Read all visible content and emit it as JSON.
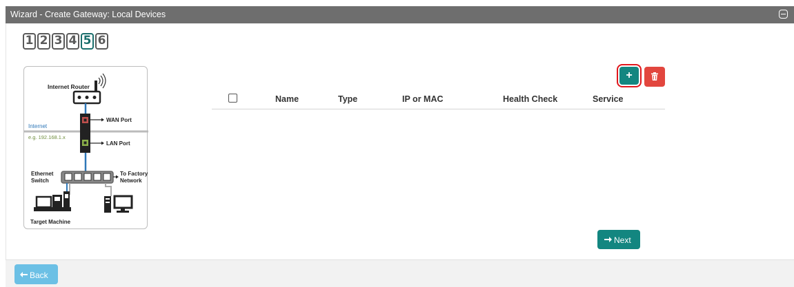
{
  "window": {
    "title": "Wizard - Create Gateway: Local Devices",
    "collapse_icon": "minus-square-icon"
  },
  "steps": {
    "items": [
      "1",
      "2",
      "3",
      "4",
      "5",
      "6"
    ],
    "active": "5"
  },
  "diagram": {
    "internet_router": "Internet Router",
    "wan_port": "WAN Port",
    "lan_port": "LAN Port",
    "internet": "Internet",
    "ip_example": "e.g. 192.168.1.x",
    "ethernet": "Ethernet",
    "switch": "Switch",
    "to_factory": "To Factory",
    "network": "Network",
    "target_machine": "Target Machine"
  },
  "toolbar": {
    "add_label": "+",
    "add_icon": "plus-icon",
    "delete_icon": "trash-icon"
  },
  "grid": {
    "columns": [
      "Name",
      "Type",
      "IP or MAC",
      "Health Check",
      "Service"
    ],
    "rows": []
  },
  "buttons": {
    "next": "Next",
    "back": "Back"
  },
  "colors": {
    "primary": "#138680",
    "danger": "#e2463e",
    "info": "#6cc0e5",
    "titlebar": "#6e6e6e",
    "highlight": "#e0161c"
  }
}
